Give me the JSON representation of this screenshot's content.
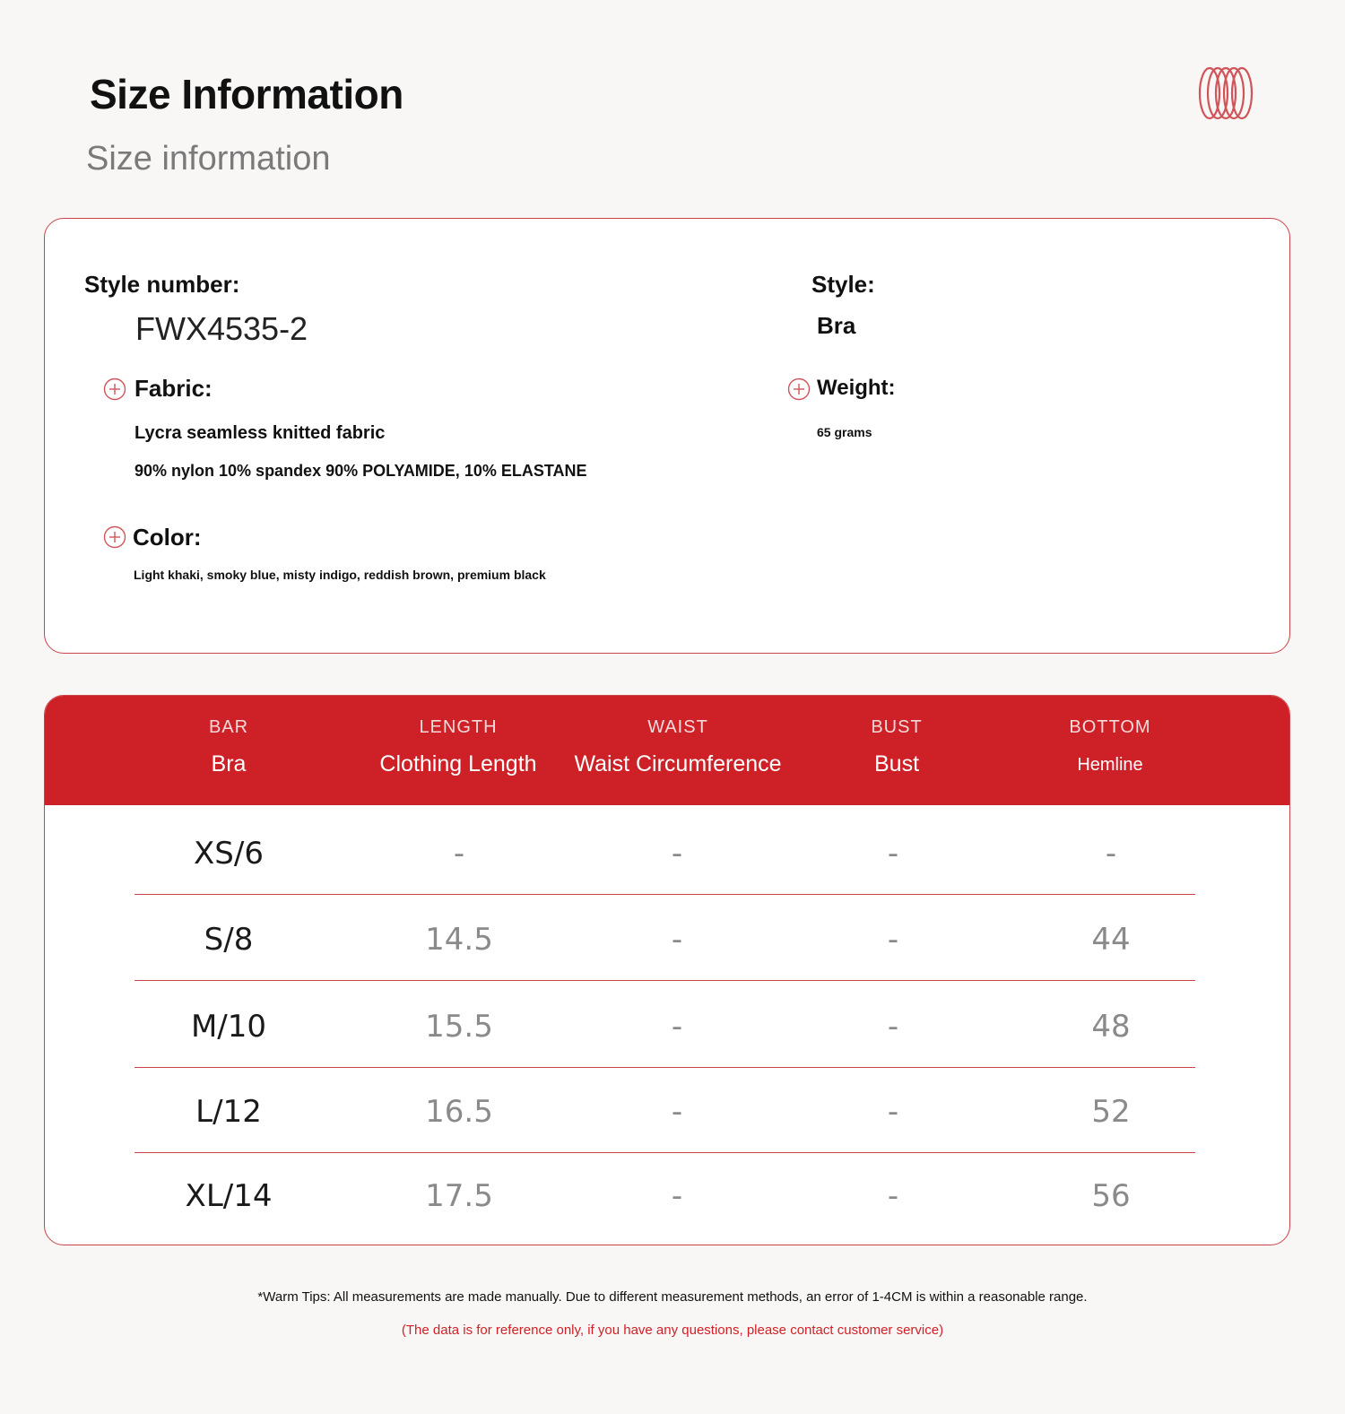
{
  "header": {
    "title": "Size Information",
    "subtitle": "Size information",
    "logo_icon": "rings-logo",
    "accent_color": "#cd2027"
  },
  "info": {
    "style_number_label": "Style number:",
    "style_number_value": "FWX4535-2",
    "style_label": "Style:",
    "style_value": "Bra",
    "fabric_label": "Fabric:",
    "fabric_line1": "Lycra seamless knitted fabric",
    "fabric_line2": "90% nylon 10% spandex 90% POLYAMIDE, 10% ELASTANE",
    "weight_label": "Weight:",
    "weight_value": "65 grams",
    "color_label": "Color:",
    "color_value": "Light khaki, smoky blue, misty indigo, reddish brown, premium black"
  },
  "table": {
    "columns": [
      {
        "en": "BAR",
        "zh": "Bra"
      },
      {
        "en": "LENGTH",
        "zh": "Clothing Length"
      },
      {
        "en": "WAIST",
        "zh": "Waist Circumference"
      },
      {
        "en": "BUST",
        "zh": "Bust"
      },
      {
        "en": "BOTTOM",
        "zh": "Hemline"
      }
    ],
    "rows": [
      [
        "XS/6",
        "-",
        "-",
        "-",
        "-"
      ],
      [
        "S/8",
        "14.5",
        "-",
        "-",
        "44"
      ],
      [
        "M/10",
        "15.5",
        "-",
        "-",
        "48"
      ],
      [
        "L/12",
        "16.5",
        "-",
        "-",
        "52"
      ],
      [
        "XL/14",
        "17.5",
        "-",
        "-",
        "56"
      ]
    ]
  },
  "footer": {
    "tip": "*Warm Tips: All measurements are made manually. Due to different measurement methods, an error of 1-4CM is within a reasonable range.",
    "note": "(The data is for reference only, if you have any questions, please contact customer service)"
  }
}
